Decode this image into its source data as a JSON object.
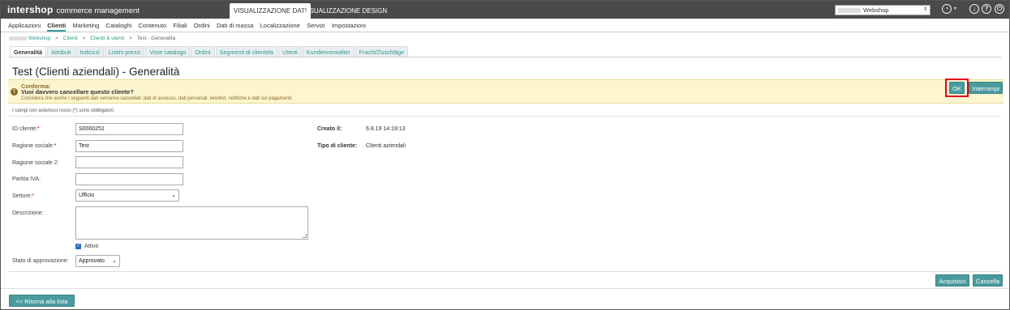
{
  "brand": {
    "name": "intershop",
    "subtitle": "commerce management"
  },
  "mode_tabs": [
    {
      "label": "VISUALIZZAZIONE DATI",
      "active": true
    },
    {
      "label": "VISUALIZZAZIONE DESIGN",
      "active": false
    }
  ],
  "site_selector": {
    "value": "Webshop"
  },
  "top_icons": [
    "speedometer-icon",
    "download-icon",
    "help-icon",
    "power-icon"
  ],
  "menu": [
    {
      "label": "Applicazioni"
    },
    {
      "label": "Clienti",
      "active": true
    },
    {
      "label": "Marketing"
    },
    {
      "label": "Cataloghi"
    },
    {
      "label": "Contenuto"
    },
    {
      "label": "Filiali"
    },
    {
      "label": "Ordini"
    },
    {
      "label": "Dati di massa"
    },
    {
      "label": "Localizzazione"
    },
    {
      "label": "Servizi"
    },
    {
      "label": "Impostazioni"
    }
  ],
  "breadcrumb": [
    "Webshop",
    "Clienti",
    "Clienti & utenti",
    "Test - Generalità"
  ],
  "tabs": [
    {
      "label": "Generalità",
      "active": true
    },
    {
      "label": "Attributi"
    },
    {
      "label": "Indirizzi"
    },
    {
      "label": "Listini prezzi"
    },
    {
      "label": "Viste catalogo"
    },
    {
      "label": "Ordini"
    },
    {
      "label": "Segmenti di clientela"
    },
    {
      "label": "Utenti"
    },
    {
      "label": "Kundenverwalter"
    },
    {
      "label": "Fracht/Zuschläge"
    }
  ],
  "page_title": "Test (Clienti aziendali) - Generalità",
  "confirm": {
    "heading": "Conferma:",
    "question": "Vuoi davvero cancellare questo cliente?",
    "detail": "Considera che anche i seguenti dati verranno cancellati: dati di accesso, dati personali, wishlist, notifiche e dati sui pagamenti.",
    "ok_label": "OK",
    "cancel_label": "Interrompi"
  },
  "required_note": {
    "before": "I campi con asterisco rosso (",
    "star": "*",
    "after": ") sono obbligatori."
  },
  "form": {
    "customer_id": {
      "label": "ID cliente:",
      "value": "S0000251"
    },
    "company_name": {
      "label": "Ragione sociale:",
      "value": "Test"
    },
    "company_name2": {
      "label": "Ragione sociale 2:",
      "value": ""
    },
    "vat": {
      "label": "Partita IVA:",
      "value": ""
    },
    "sector": {
      "label": "Settore:",
      "value": "Ufficio"
    },
    "description": {
      "label": "Descrizione:",
      "value": ""
    },
    "active": {
      "label": "Attivo",
      "checked": true
    },
    "approval": {
      "label": "Stato di approvazione:",
      "value": "Approvato"
    }
  },
  "info": {
    "created_label": "Creato il:",
    "created_value": "6.8.19 14:19:13",
    "type_label": "Tipo di cliente:",
    "type_value": "Clienti aziendali"
  },
  "actions": {
    "apply": "Acquisisci",
    "delete": "Cancella",
    "back": "<< Ritorna alla lista"
  },
  "colors": {
    "accent": "#4a9a9e",
    "warning_bg": "#fcf5d0",
    "highlight": "#e0001a",
    "topbar": "#4a4a4a"
  }
}
